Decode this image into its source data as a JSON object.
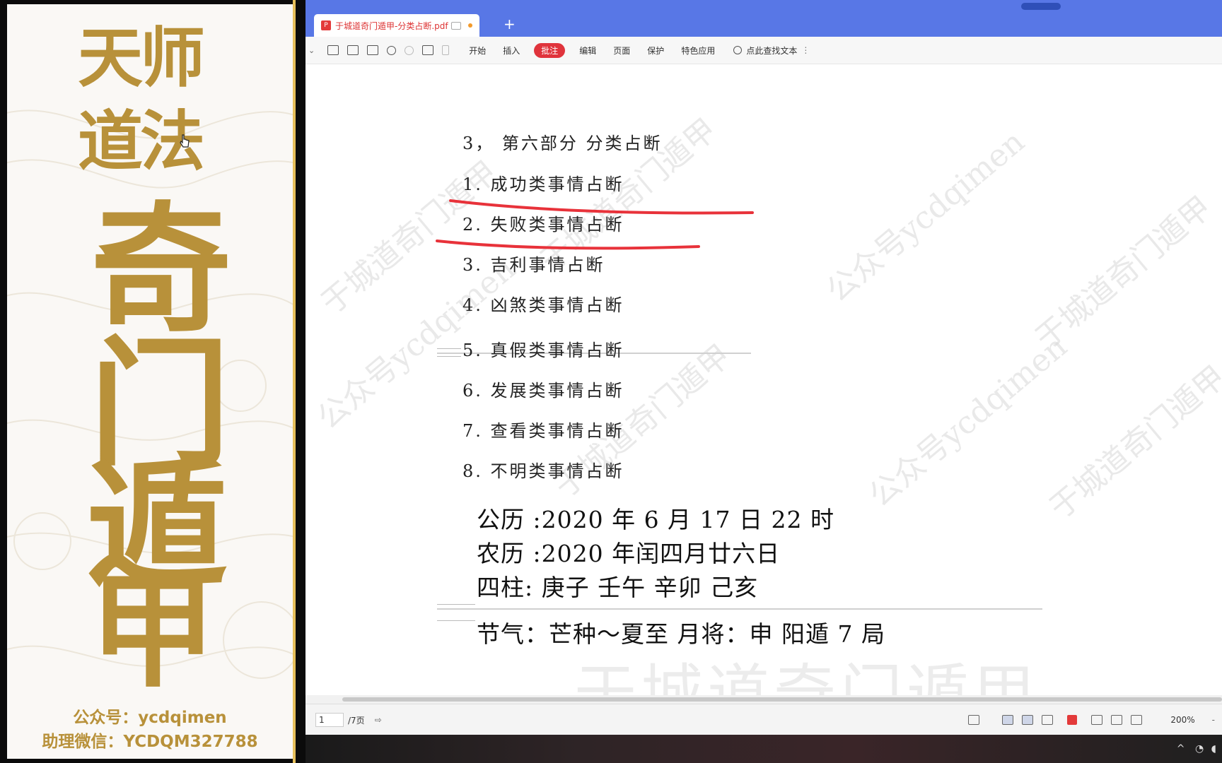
{
  "banner": {
    "title_line1": "天师",
    "title_line2": "道法",
    "big_chars": [
      "奇",
      "门",
      "遁",
      "甲"
    ],
    "contact_line1": "公众号：ycdqimen",
    "contact_line2": "助理微信：YCDQM327788",
    "gold_color": "#b8913a"
  },
  "tab": {
    "title": "于城道奇门遁甲-分类占断.pdf *",
    "new_tab": "+"
  },
  "toolbar": {
    "menus": [
      "开始",
      "插入",
      "批注",
      "编辑",
      "页面",
      "保护",
      "特色应用"
    ],
    "active_menu": "批注",
    "search_text": "点此查找文本"
  },
  "document": {
    "heading": "3， 第六部分  分类占断",
    "items": [
      "1. 成功类事情占断",
      "2. 失败类事情占断",
      "3. 吉利事情占断",
      "4. 凶煞类事情占断",
      "5. 真假类事情占断",
      "6. 发展类事情占断",
      "7. 查看类事情占断",
      "8. 不明类事情占断"
    ],
    "calendar": {
      "solar": "公历  :2020 年 6 月 17 日 22 时",
      "lunar": "农历  :2020 年闰四月廿六日",
      "pillars": "四柱:  庚子    壬午    辛卯    己亥",
      "partial": "节气：芒种～夏至        月将：申    阳遁 7 局"
    },
    "watermark_cn": "于城道奇门遁甲",
    "watermark_en": "公众号ycdqimen",
    "annotation_color": "#e8323a"
  },
  "status": {
    "page_current": "1",
    "page_total": "/7页",
    "zoom": "200%"
  }
}
